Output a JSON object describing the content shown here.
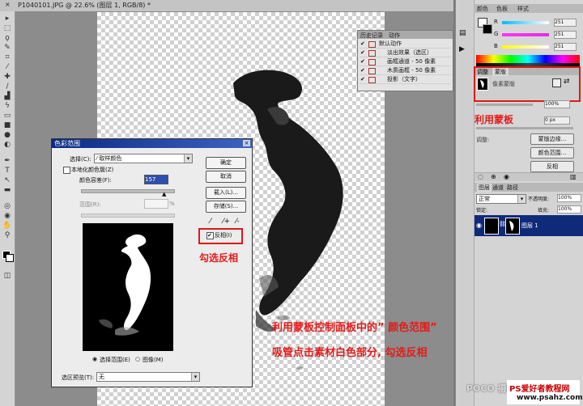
{
  "document": {
    "tab_title": "P1040101.JPG @ 22.6% (图层 1, RGB/8) *",
    "close_glyph": "×"
  },
  "history_panel": {
    "tabs": [
      "历史记录",
      "动作"
    ],
    "rows": [
      {
        "check": "✔",
        "label": "默认动作"
      },
      {
        "check": "✔",
        "label": "淡出效果（选区）"
      },
      {
        "check": "✔",
        "label": "画框通道 - 50 像素"
      },
      {
        "check": "✔",
        "label": "木质画框 - 50 像素"
      },
      {
        "check": "✔",
        "label": "投影（文字）"
      }
    ]
  },
  "color_panel": {
    "tabs": [
      "颜色",
      "色板",
      "样式"
    ],
    "sliders": [
      {
        "label": "R",
        "value": "251",
        "color": "#e0e0e0"
      },
      {
        "label": "G",
        "value": "251",
        "color": "#d33bd3"
      },
      {
        "label": "B",
        "value": "251",
        "color": "#e0e0e0"
      }
    ]
  },
  "mask_panel": {
    "tabs": [
      "调整",
      "蒙版"
    ],
    "mode_label": "像素蒙版",
    "density_value": "100%",
    "feather_value": "0 px",
    "adjust_label": "调整:",
    "buttons": [
      "蒙版边缘...",
      "颜色范围...",
      "反相"
    ]
  },
  "layers_panel": {
    "tabs": [
      "图层",
      "通道",
      "路径"
    ],
    "blend_mode": "正常",
    "opacity_label": "不透明度:",
    "opacity_value": "100%",
    "lock_label": "锁定:",
    "fill_label": "填充:",
    "fill_value": "100%",
    "layer_name": "图层 1"
  },
  "dialog": {
    "title": "色彩范围",
    "close_glyph": "×",
    "select_label": "选择(C):",
    "select_value": "取样颜色",
    "localized_label": "本地化颜色簇(Z)",
    "fuzziness_label": "颜色容差(F):",
    "fuzziness_value": "157",
    "range_label": "范围(R):",
    "range_unit": "%",
    "buttons": [
      "确定",
      "取消",
      "载入(L)...",
      "存储(S)..."
    ],
    "invert_label": "反相(I)",
    "radio_selection": "选择范围(E)",
    "radio_image": "图像(M)",
    "preview_label": "选区预览(T):",
    "preview_value": "无"
  },
  "annotations": {
    "use_mask": "利用蒙板",
    "check_invert": "勾选反相",
    "line1": "利用蒙板控制面板中的” 颜色范围”",
    "line2": "吸管点击素材白色部分, 勾选反相"
  },
  "watermark": {
    "poco": "POCO 摄影专题",
    "site": "PS爱好者教程网",
    "url": "www.psahz.com"
  }
}
